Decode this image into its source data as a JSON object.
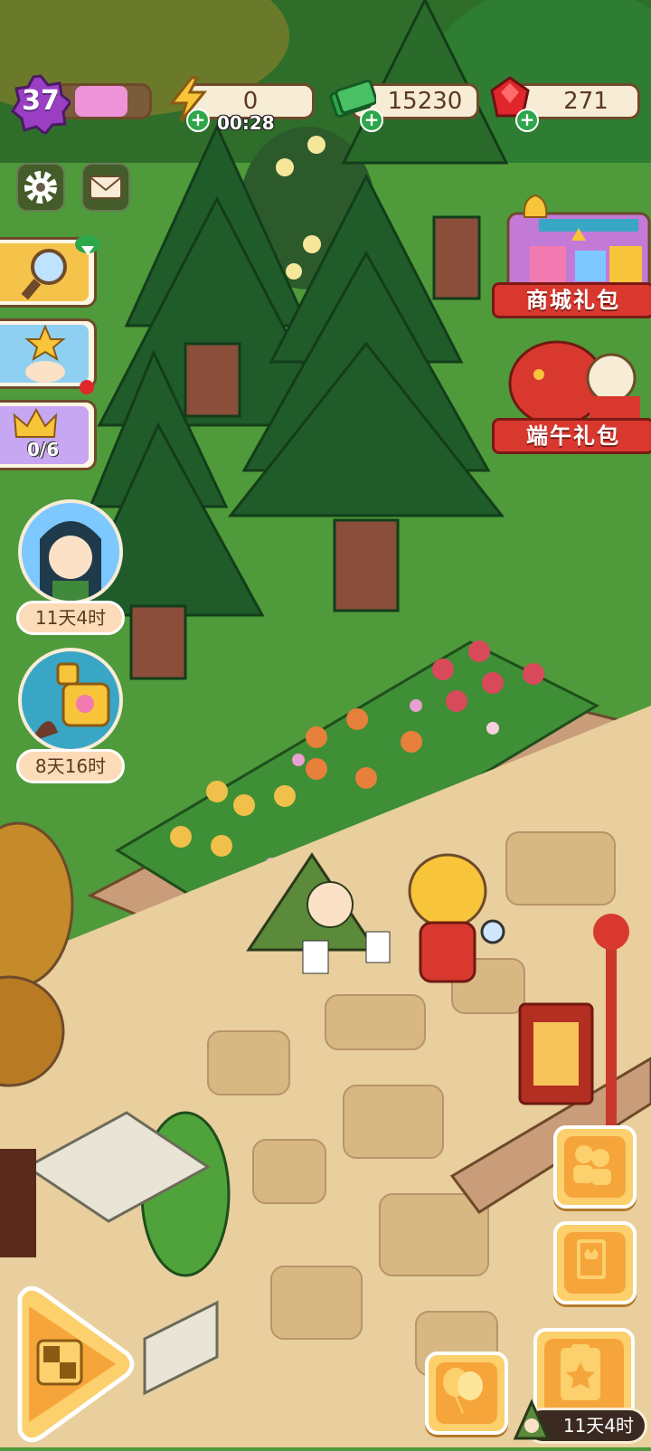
{
  "hud": {
    "level": "37",
    "energy_value": "0",
    "energy_timer": "00:28",
    "cash_value": "15230",
    "gem_value": "271",
    "plus_symbol": "+"
  },
  "icons": {
    "settings": "gear-icon",
    "mail": "mail-icon",
    "lightning": "lightning-icon",
    "cash": "cash-icon",
    "gem": "gem-icon"
  },
  "side_cards": {
    "collection_counter": "0/6"
  },
  "events": [
    {
      "timer": "11天4时"
    },
    {
      "timer": "8天16时"
    }
  ],
  "gifts": {
    "shop_label": "商城礼包",
    "festival_label": "端午礼包"
  },
  "bottom": {
    "timer": "11天4时"
  },
  "colors": {
    "grass": "#4f9a3a",
    "path": "#e8cf9d",
    "button_gold": "#fcd06c",
    "banner_red": "#d8382e"
  }
}
